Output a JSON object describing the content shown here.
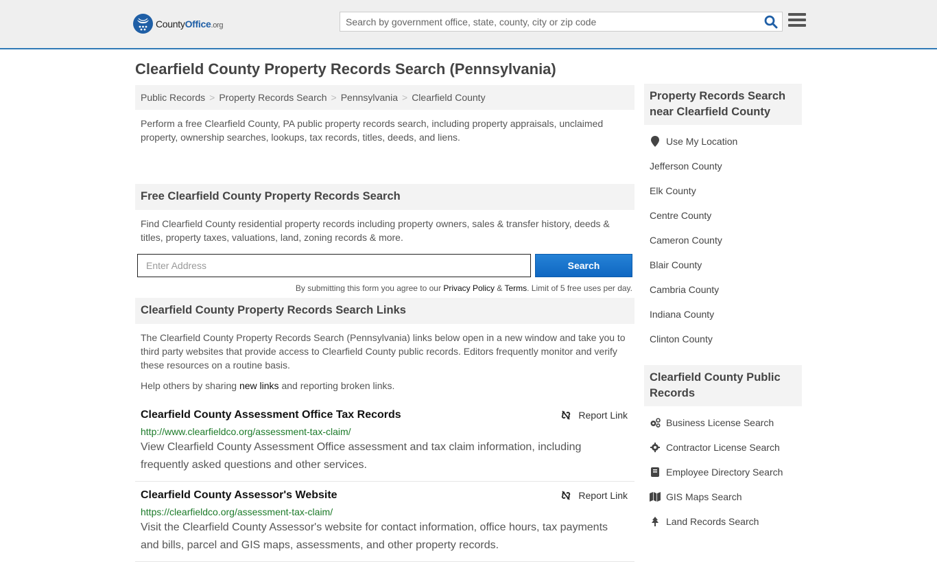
{
  "header": {
    "logo_main": "County",
    "logo_bold": "Office",
    "logo_suffix": ".org",
    "search_placeholder": "Search by government office, state, county, city or zip code"
  },
  "page_title": "Clearfield County Property Records Search (Pennsylvania)",
  "breadcrumb": [
    {
      "label": "Public Records"
    },
    {
      "label": "Property Records Search"
    },
    {
      "label": "Pennsylvania"
    },
    {
      "label": "Clearfield County"
    }
  ],
  "breadcrumb_separator": ">",
  "intro": "Perform a free Clearfield County, PA public property records search, including property appraisals, unclaimed property, ownership searches, lookups, tax records, titles, deeds, and liens.",
  "free_search": {
    "heading": "Free Clearfield County Property Records Search",
    "text": "Find Clearfield County residential property records including property owners, sales & transfer history, deeds & titles, property taxes, valuations, land, zoning records & more.",
    "input_placeholder": "Enter Address",
    "button_label": "Search",
    "disclaimer_prefix": "By submitting this form you agree to our ",
    "privacy_label": "Privacy Policy",
    "amp": " & ",
    "terms_label": "Terms",
    "disclaimer_suffix": ". Limit of 5 free uses per day."
  },
  "links_section": {
    "heading": "Clearfield County Property Records Search Links",
    "text": "The Clearfield County Property Records Search (Pennsylvania) links below open in a new window and take you to third party websites that provide access to Clearfield County public records. Editors frequently monitor and verify these resources on a routine basis.",
    "help_prefix": "Help others by sharing ",
    "help_link": "new links",
    "help_suffix": " and reporting broken links.",
    "report_label": "Report Link",
    "items": [
      {
        "title": "Clearfield County Assessment Office Tax Records",
        "url": "http://www.clearfieldco.org/assessment-tax-claim/",
        "description": "View Clearfield County Assessment Office assessment and tax claim information, including frequently asked questions and other services."
      },
      {
        "title": "Clearfield County Assessor's Website",
        "url": "https://clearfieldco.org/assessment-tax-claim/",
        "description": "Visit the Clearfield County Assessor's website for contact information, office hours, tax payments and bills, parcel and GIS maps, assessments, and other property records."
      }
    ]
  },
  "sidebar": {
    "nearby_heading": "Property Records Search near Clearfield County",
    "use_location": "Use My Location",
    "nearby": [
      {
        "label": "Jefferson County"
      },
      {
        "label": "Elk County"
      },
      {
        "label": "Centre County"
      },
      {
        "label": "Cameron County"
      },
      {
        "label": "Blair County"
      },
      {
        "label": "Cambria County"
      },
      {
        "label": "Indiana County"
      },
      {
        "label": "Clinton County"
      }
    ],
    "public_heading": "Clearfield County Public Records",
    "public": [
      {
        "label": "Business License Search",
        "icon": "cogs-icon"
      },
      {
        "label": "Contractor License Search",
        "icon": "cog-icon"
      },
      {
        "label": "Employee Directory Search",
        "icon": "book-icon"
      },
      {
        "label": "GIS Maps Search",
        "icon": "map-icon"
      },
      {
        "label": "Land Records Search",
        "icon": "tree-icon"
      }
    ]
  },
  "colors": {
    "brand_blue": "#1f5fa6",
    "header_border": "#2f79b6",
    "url_green": "#1b7a28",
    "button_blue": "#1a74cc"
  }
}
